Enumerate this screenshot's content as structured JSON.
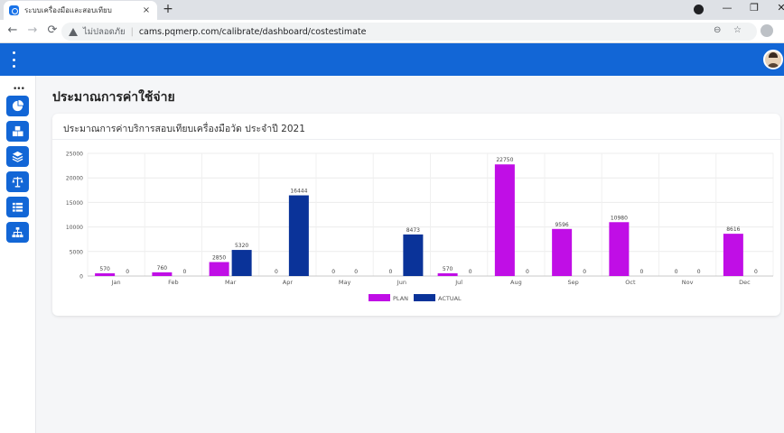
{
  "browser": {
    "tab_title": "ระบบเครื่องมือและสอบเทียบ",
    "tab_close": "×",
    "new_tab": "+",
    "url_prefix": "ไม่ปลอดภัย",
    "url": "cams.pqmerp.com/calibrate/dashboard/costestimate",
    "back": "←",
    "forward": "→",
    "reload": "⟳",
    "zoom_icon": "⊖",
    "star_icon": "☆",
    "win_minimize": "—",
    "win_restore": "❐",
    "win_close": "✕"
  },
  "sidebar": {
    "dots": "•••",
    "items": [
      {
        "name": "dashboard-icon"
      },
      {
        "name": "boxes-icon"
      },
      {
        "name": "layers-icon"
      },
      {
        "name": "scale-icon"
      },
      {
        "name": "list-icon"
      },
      {
        "name": "sitemap-icon"
      }
    ]
  },
  "page": {
    "title": "ประมาณการค่าใช้จ่าย",
    "card_title": "ประมาณการค่าบริการสอบเทียบเครื่องมือวัด ประจำปี 2021"
  },
  "colors": {
    "brand": "#1266d6",
    "plan": "#c00ee6",
    "actual": "#0a3399"
  },
  "chart_data": {
    "type": "bar",
    "categories": [
      "Jan",
      "Feb",
      "Mar",
      "Apr",
      "May",
      "Jun",
      "Jul",
      "Aug",
      "Sep",
      "Oct",
      "Nov",
      "Dec"
    ],
    "series": [
      {
        "name": "PLAN",
        "values": [
          570,
          760,
          2850,
          0,
          0,
          0,
          570,
          22750,
          9596,
          10980,
          0,
          8616
        ]
      },
      {
        "name": "ACTUAL",
        "values": [
          0,
          0,
          5320,
          16444,
          0,
          8473,
          0,
          0,
          0,
          0,
          0,
          0
        ]
      }
    ],
    "yticks": [
      0,
      5000,
      10000,
      15000,
      20000,
      25000
    ],
    "ylim": [
      0,
      25000
    ],
    "grid": true,
    "legend": "bottom-center"
  }
}
